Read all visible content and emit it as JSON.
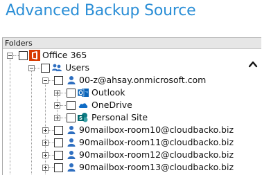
{
  "title": "Advanced Backup Source",
  "panel": {
    "header": "Folders"
  },
  "tree": {
    "office365": "Office 365",
    "users": "Users",
    "user0": "00-z@ahsay.onmicrosoft.com",
    "outlook": "Outlook",
    "onedrive": "OneDrive",
    "personal_site": "Personal Site",
    "room10": "90mailbox-room10@cloudbacko.biz",
    "room11": "90mailbox-room11@cloudbacko.biz",
    "room12": "90mailbox-room12@cloudbacko.biz",
    "room13": "90mailbox-room13@cloudbacko.biz"
  },
  "icons": {
    "office365": "office365-icon",
    "users": "users-group-icon",
    "user": "user-icon",
    "outlook": "outlook-icon",
    "onedrive": "onedrive-cloud-icon",
    "sharepoint": "sharepoint-icon",
    "scroll_up": "scroll-up-chevron-icon"
  },
  "colors": {
    "title": "#2a8ed6",
    "office_red": "#d83b01",
    "user_blue": "#2f6fc0",
    "outlook_blue": "#0a64b8",
    "onedrive_blue": "#0f6cc6",
    "sharepoint_teal": "#0f7c86"
  }
}
